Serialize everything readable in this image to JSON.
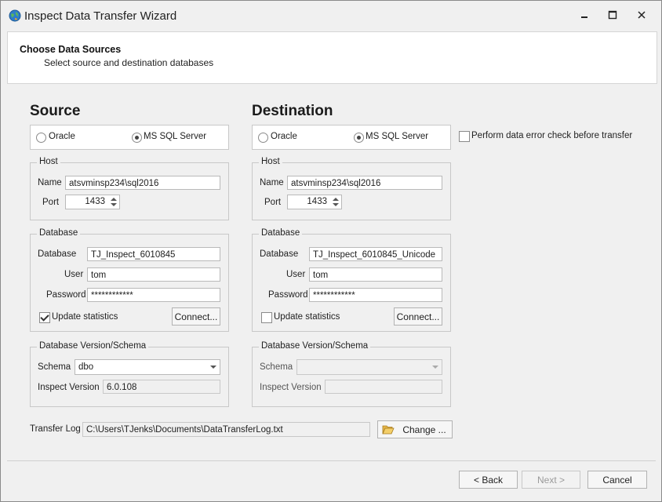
{
  "window": {
    "title": "Inspect Data Transfer Wizard"
  },
  "header": {
    "title": "Choose Data Sources",
    "subtitle": "Select source and destination databases"
  },
  "source": {
    "title": "Source",
    "radio_oracle": "Oracle",
    "radio_mssql": "MS SQL Server",
    "selected": "MS SQL Server",
    "host": {
      "legend": "Host",
      "name_label": "Name",
      "name_value": "atsvminsp234\\sql2016",
      "port_label": "Port",
      "port_value": "1433"
    },
    "database": {
      "legend": "Database",
      "database_label": "Database",
      "database_value": "TJ_Inspect_6010845",
      "user_label": "User",
      "user_value": "tom",
      "password_label": "Password",
      "password_value": "************",
      "update_stats_label": "Update statistics",
      "update_stats_checked": true,
      "connect_label": "Connect..."
    },
    "version": {
      "legend": "Database Version/Schema",
      "schema_label": "Schema",
      "schema_value": "dbo",
      "inspect_version_label": "Inspect Version",
      "inspect_version_value": "6.0.108"
    }
  },
  "destination": {
    "title": "Destination",
    "radio_oracle": "Oracle",
    "radio_mssql": "MS SQL Server",
    "selected": "MS SQL Server",
    "host": {
      "legend": "Host",
      "name_label": "Name",
      "name_value": "atsvminsp234\\sql2016",
      "port_label": "Port",
      "port_value": "1433"
    },
    "database": {
      "legend": "Database",
      "database_label": "Database",
      "database_value": "TJ_Inspect_6010845_Unicode",
      "user_label": "User",
      "user_value": "tom",
      "password_label": "Password",
      "password_value": "************",
      "update_stats_label": "Update statistics",
      "update_stats_checked": false,
      "connect_label": "Connect..."
    },
    "version": {
      "legend": "Database Version/Schema",
      "schema_label": "Schema",
      "schema_value": "",
      "inspect_version_label": "Inspect Version",
      "inspect_version_value": ""
    }
  },
  "error_check": {
    "label": "Perform data error check before transfer",
    "checked": false
  },
  "transfer_log": {
    "label": "Transfer Log",
    "path": "C:\\Users\\TJenks\\Documents\\DataTransferLog.txt",
    "change_label": "Change ..."
  },
  "footer": {
    "back_label": "< Back",
    "next_label": "Next >",
    "cancel_label": "Cancel"
  },
  "icons": {
    "app": "globe-icon",
    "minimize": "minimize-icon",
    "maximize": "maximize-icon",
    "close": "close-icon",
    "folder": "folder-open-icon"
  },
  "colors": {
    "window_bg": "#f0f0f0",
    "panel_bg": "#ffffff",
    "border": "#c8c8c8"
  }
}
